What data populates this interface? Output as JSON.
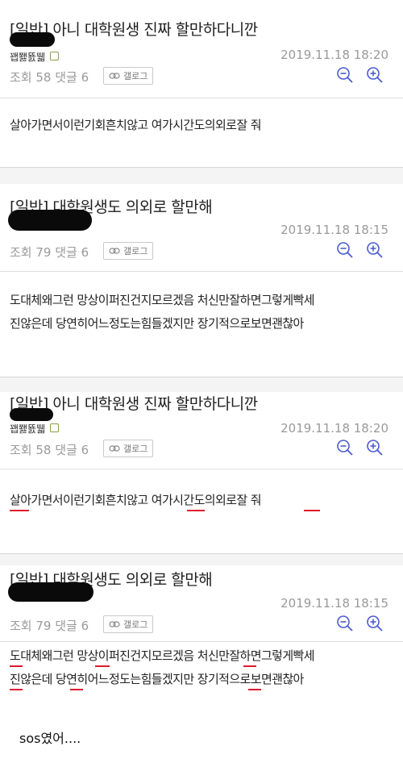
{
  "posts": [
    {
      "title": "[일반] 아니 대학원생 진짜 할만하다니깐",
      "author": "꽵쬃뚌뛟",
      "datetime": "2019.11.18 18:20",
      "views_label": "조회 58",
      "comments_label": "댓글 6",
      "gallog_label": "갤로그",
      "body_lines": [
        "살아가면서이런기회흔치않고 여가시간도의외로잘 줘"
      ]
    },
    {
      "title": "[일반] 대학원생도 의외로 할만해",
      "author": "",
      "datetime": "2019.11.18 18:15",
      "views_label": "조회 79",
      "comments_label": "댓글 6",
      "gallog_label": "갤로그",
      "body_lines": [
        "도대체왜그런 망상이퍼진건지모르겠음 처신만잘하면그렇게빡세",
        "진않은데 당연히어느정도는힘들겠지만 장기적으로보면괜찮아"
      ]
    },
    {
      "title": "[일반] 아니 대학원생 진짜 할만하다니깐",
      "author": "꽵쬃뚌뛟",
      "datetime": "2019.11.18 18:20",
      "views_label": "조회 58",
      "comments_label": "댓글 6",
      "gallog_label": "갤로그",
      "body_lines": [
        "살아가면서이런기회흔치않고 여가시간도의외로잘 줘"
      ]
    },
    {
      "title": "[일반] 대학원생도 의외로 할만해",
      "author": "",
      "datetime": "2019.11.18 18:15",
      "views_label": "조회 79",
      "comments_label": "댓글 6",
      "gallog_label": "갤로그",
      "body_lines": [
        "도대체왜그런 망상이퍼진건지모르겠음 처신만잘하면그렇게빡세",
        "진않은데 당연히어느정도는힘들겠지만 장기적으로보면괜찮아"
      ]
    }
  ],
  "caption": "sos였어....",
  "icons": {
    "zoom_out": "zoom-out-icon",
    "zoom_in": "zoom-in-icon",
    "gallog": "link-icon",
    "member": "fixed-nick-badge-icon"
  },
  "colors": {
    "underline": "#e0192d",
    "zoom_icon": "#4a5bd4",
    "muted_text": "#9a9a9a"
  }
}
